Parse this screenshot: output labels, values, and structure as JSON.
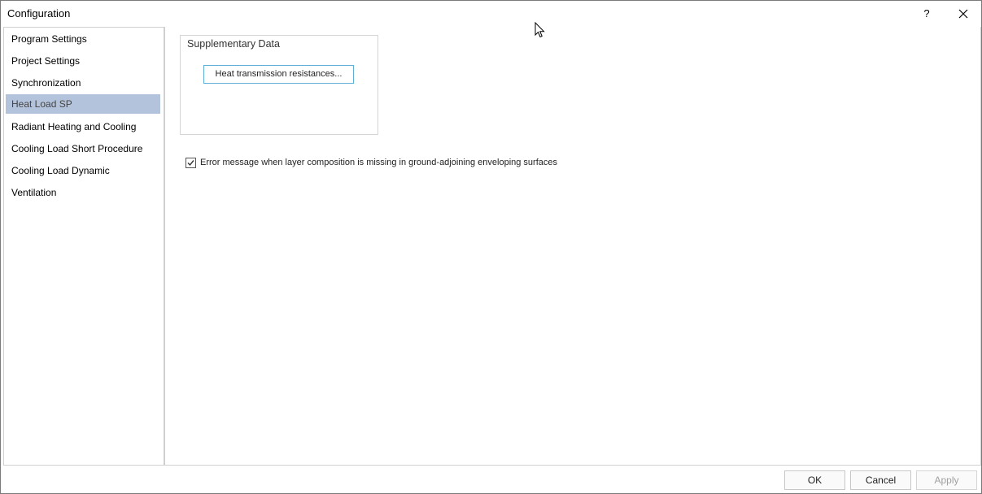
{
  "window": {
    "title": "Configuration",
    "help_label": "?"
  },
  "sidebar": {
    "items": [
      {
        "label": "Program Settings"
      },
      {
        "label": "Project Settings"
      },
      {
        "label": "Synchronization"
      },
      {
        "label": "Heat Load SP",
        "selected": true
      },
      {
        "label": "Radiant Heating and Cooling"
      },
      {
        "label": "Cooling Load Short Procedure"
      },
      {
        "label": "Cooling Load Dynamic"
      },
      {
        "label": "Ventilation"
      }
    ]
  },
  "content": {
    "group_title": "Supplementary Data",
    "heat_button_label": "Heat transmission resistances...",
    "error_checkbox": {
      "label": "Error message when layer composition is missing in ground-adjoining enveloping surfaces",
      "checked": true
    }
  },
  "footer": {
    "ok_label": "OK",
    "cancel_label": "Cancel",
    "apply_label": "Apply"
  },
  "colors": {
    "selected_bg": "#b4c3dc",
    "button_focus_border": "#5fb0d8"
  },
  "icons": {
    "close": "close-icon",
    "check": "check-icon",
    "cursor": "mouse-pointer-icon"
  }
}
